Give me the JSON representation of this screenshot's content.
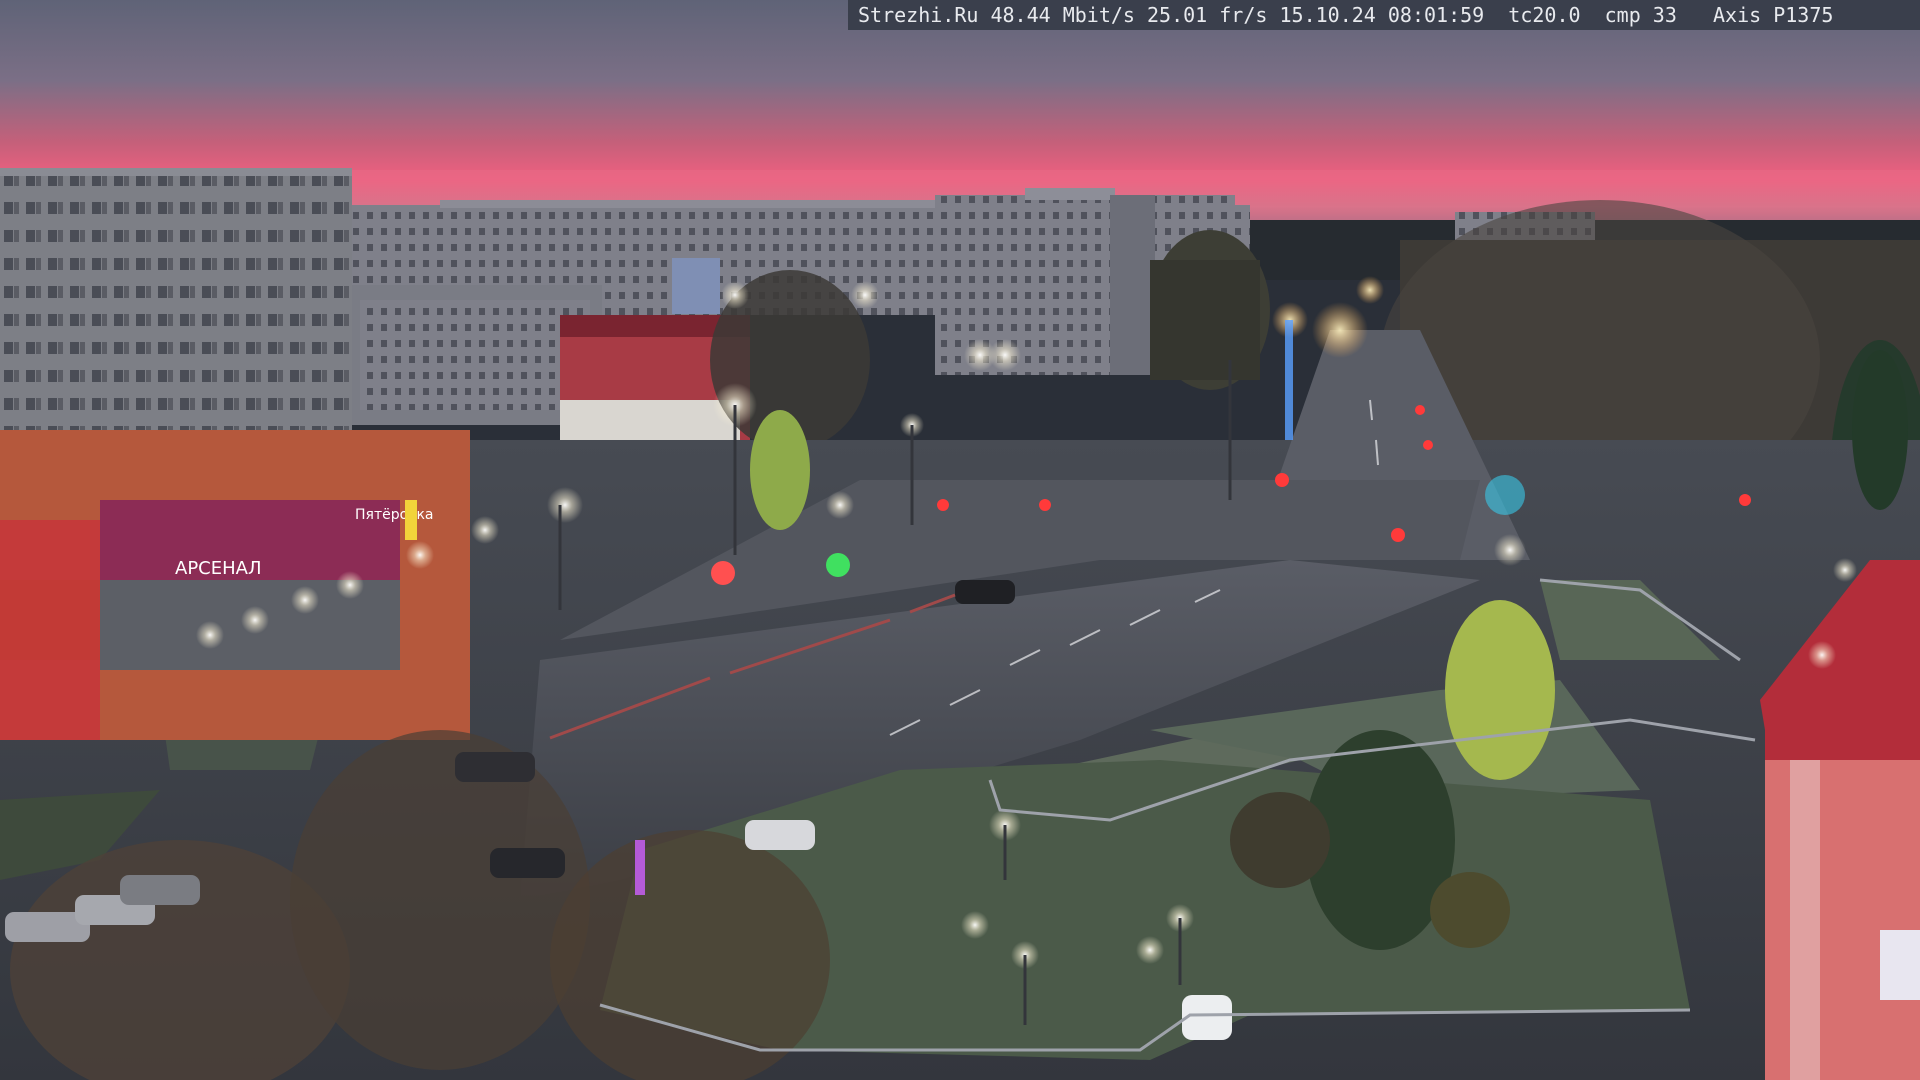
{
  "overlay": {
    "site": "Strezhi.Ru",
    "bitrate": "48.44 Mbit/s",
    "framerate": "25.01 fr/s",
    "date": "15.10.24",
    "time": "08:01:59",
    "tc": "tc20.0",
    "cmp": "cmp 33",
    "camera": "Axis P1375"
  },
  "signs": {
    "store_1": "АРСЕНАЛ",
    "store_2": "Пятёрочка"
  },
  "colors": {
    "sky_top": "#6f6f86",
    "sky_glow": "#e0506a",
    "horizon": "#f3708a",
    "asphalt": "#3c4048",
    "grass": "#4a5a48",
    "store_facade": "#b2583a"
  }
}
